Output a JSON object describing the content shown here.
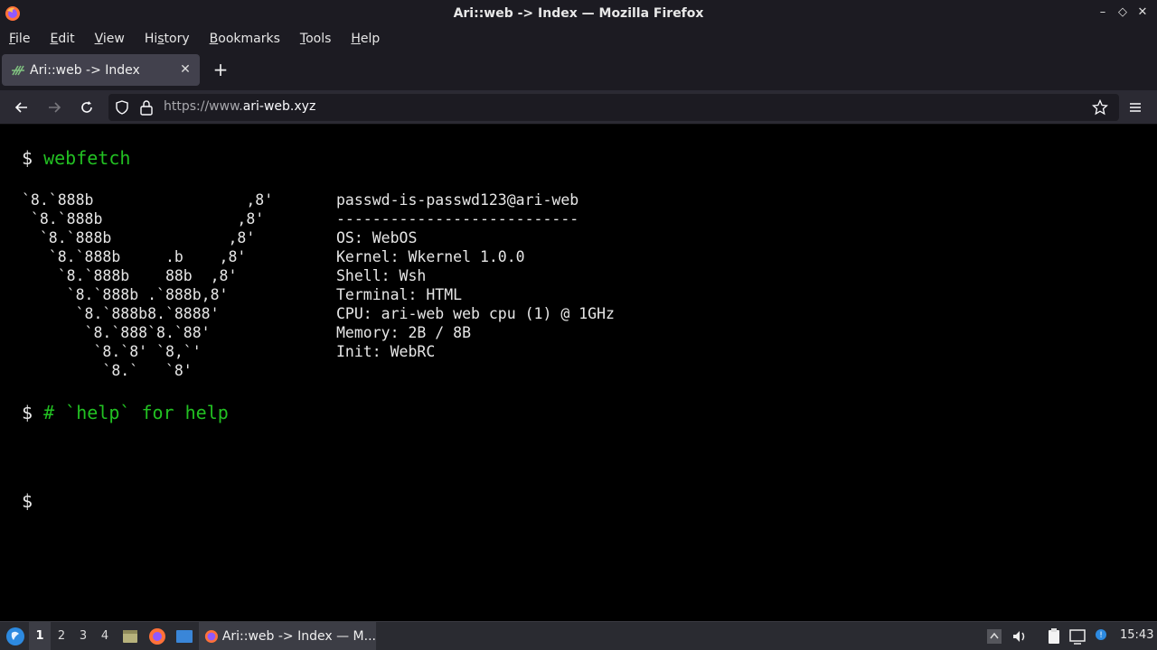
{
  "window": {
    "title": "Ari::web -> Index — Mozilla Firefox"
  },
  "menu": {
    "items": [
      {
        "label": "File",
        "accel": "F",
        "rest": "ile"
      },
      {
        "label": "Edit",
        "accel": "E",
        "rest": "dit"
      },
      {
        "label": "View",
        "accel": "V",
        "rest": "iew"
      },
      {
        "label": "History",
        "accel": "s",
        "pre": "Hi",
        "rest": "tory"
      },
      {
        "label": "Bookmarks",
        "accel": "B",
        "rest": "ookmarks"
      },
      {
        "label": "Tools",
        "accel": "T",
        "rest": "ools"
      },
      {
        "label": "Help",
        "accel": "H",
        "rest": "elp"
      }
    ]
  },
  "tab": {
    "label": "Ari::web -> Index"
  },
  "urlbar": {
    "scheme_prefix": "https://www.",
    "host": "ari-web.xyz"
  },
  "terminal": {
    "command1_prompt": "$",
    "command1": "webfetch",
    "ascii_art": [
      "`8.`888b                 ,8'",
      " `8.`888b               ,8'",
      "  `8.`888b             ,8'",
      "   `8.`888b     .b    ,8'",
      "    `8.`888b    88b  ,8'",
      "     `8.`888b .`888b,8'",
      "      `8.`888b8.`8888'",
      "       `8.`888`8.`88'",
      "        `8.`8' `8,`'",
      "         `8.`   `8'"
    ],
    "info": [
      "passwd-is-passwd123@ari-web",
      "---------------------------",
      "OS: WebOS",
      "Kernel: Wkernel 1.0.0",
      "Shell: Wsh",
      "Terminal: HTML",
      "CPU: ari-web web cpu (1) @ 1GHz",
      "Memory: 2B / 8B",
      "Init: WebRC"
    ],
    "comment_prompt": "$",
    "comment": "# `help` for help",
    "input_prompt": "$"
  },
  "taskbar": {
    "workspaces": [
      "1",
      "2",
      "3",
      "4"
    ],
    "active_workspace": "1",
    "window_label": "Ari::web -> Index — M...",
    "clock": "15:43"
  }
}
